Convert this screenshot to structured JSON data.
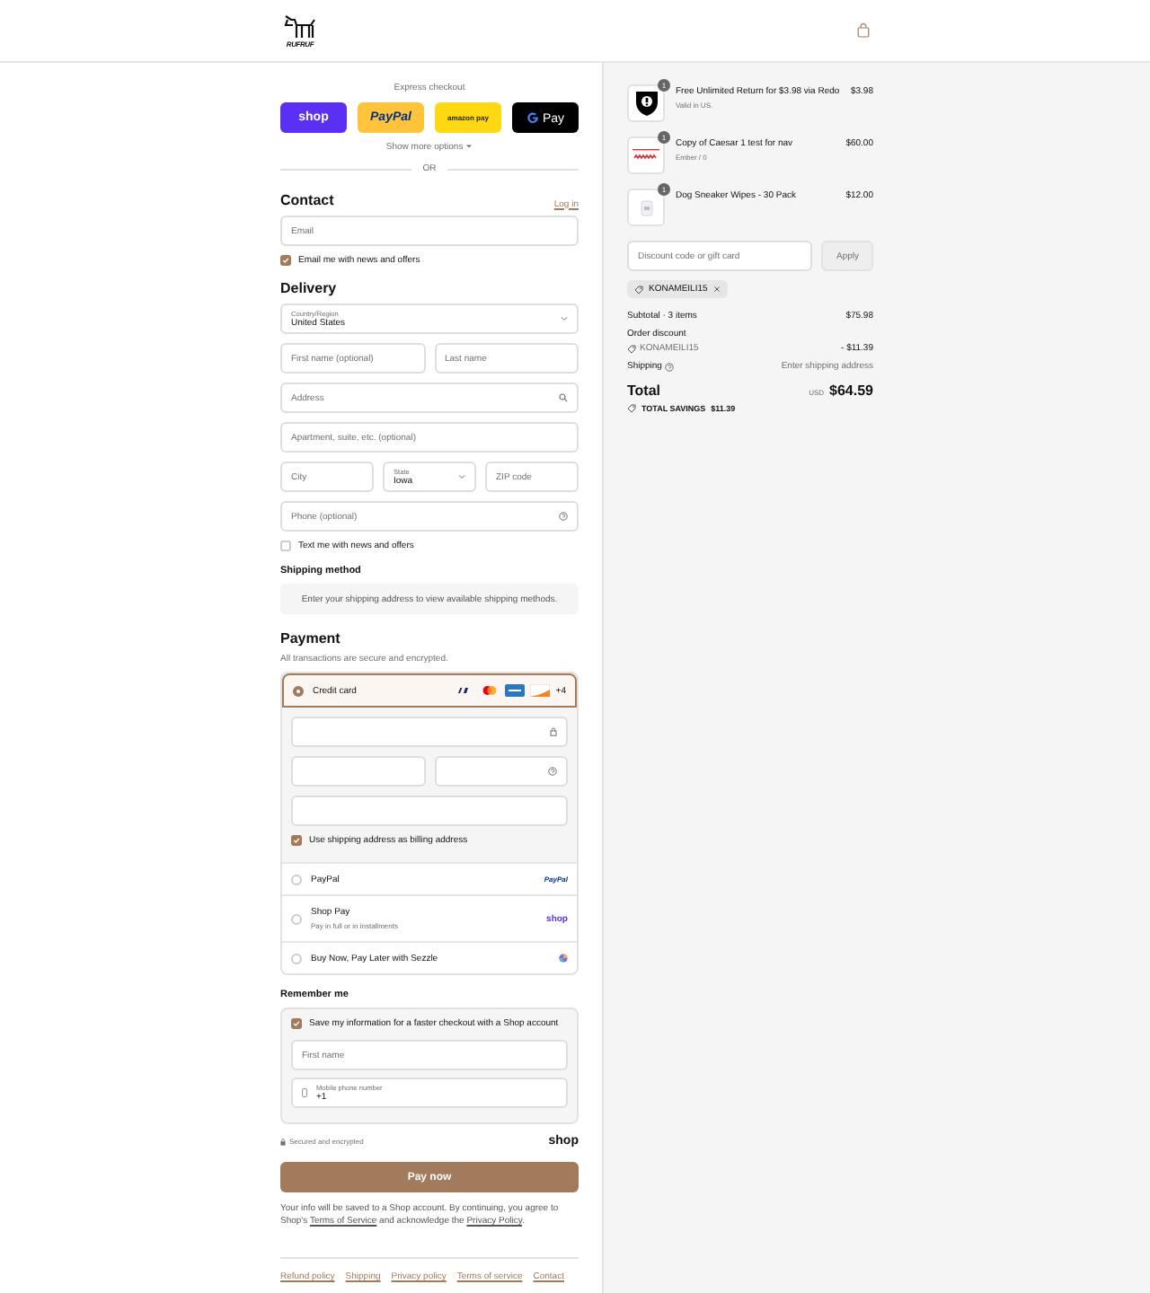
{
  "header": {
    "brand": "RUFRUF"
  },
  "express": {
    "label": "Express checkout",
    "buttons": [
      {
        "kind": "shop",
        "label": "shop"
      },
      {
        "kind": "paypal",
        "label": "PayPal"
      },
      {
        "kind": "amazon",
        "label": "amazon pay"
      },
      {
        "kind": "gpay",
        "label": "Pay"
      }
    ],
    "show_more": "Show more options",
    "or": "OR"
  },
  "contact": {
    "title": "Contact",
    "login": "Log in",
    "email": {
      "placeholder": "Email"
    },
    "news": {
      "label": "Email me with news and offers",
      "checked": true
    }
  },
  "delivery": {
    "title": "Delivery",
    "rows": [
      [
        {
          "kind": "select",
          "label": "Country/Region",
          "value": "United States"
        }
      ],
      [
        {
          "kind": "text",
          "placeholder": "First name (optional)"
        },
        {
          "kind": "text",
          "placeholder": "Last name"
        }
      ],
      [
        {
          "kind": "search",
          "placeholder": "Address"
        }
      ],
      [
        {
          "kind": "text",
          "placeholder": "Apartment, suite, etc. (optional)"
        }
      ],
      [
        {
          "kind": "text",
          "placeholder": "City"
        },
        {
          "kind": "select",
          "label": "State",
          "value": "Iowa"
        },
        {
          "kind": "text",
          "placeholder": "ZIP code"
        }
      ],
      [
        {
          "kind": "help",
          "placeholder": "Phone (optional)"
        }
      ]
    ],
    "sms": {
      "label": "Text me with news and offers",
      "checked": false
    }
  },
  "shipping_method": {
    "title": "Shipping method",
    "notice": "Enter your shipping address to view available shipping methods."
  },
  "payment": {
    "title": "Payment",
    "subtitle": "All transactions are secure and encrypted.",
    "more_brands": "+4",
    "methods": [
      {
        "kind": "card",
        "label": "Credit card",
        "selected": true
      },
      {
        "kind": "paypal",
        "label": "PayPal",
        "logo": "PayPal",
        "selected": false
      },
      {
        "kind": "shop",
        "label": "Shop Pay",
        "sub": "Pay in full or in installments",
        "logo": "shop",
        "selected": false
      },
      {
        "kind": "sezzle",
        "label": "Buy Now, Pay Later with Sezzle",
        "selected": false
      }
    ],
    "billing": {
      "label": "Use shipping address as billing address",
      "checked": true
    }
  },
  "remember": {
    "title": "Remember me",
    "save": {
      "label": "Save my information for a faster checkout with a Shop account",
      "checked": true
    },
    "first_name": {
      "placeholder": "First name"
    },
    "mobile": {
      "label": "Mobile phone number",
      "value": "+1"
    }
  },
  "secure": {
    "label": "Secured and encrypted",
    "logo": "shop"
  },
  "pay_button": "Pay now",
  "legal": [
    {
      "text": "Your info will be saved to a Shop account. By continuing, you agree to Shop's ",
      "link": false
    },
    {
      "text": "Terms of Service",
      "link": true
    },
    {
      "text": " and acknowledge the ",
      "link": false
    },
    {
      "text": "Privacy Policy",
      "link": true
    },
    {
      "text": ".",
      "link": false
    }
  ],
  "footer_links": [
    "Refund policy",
    "Shipping",
    "Privacy policy",
    "Terms of service",
    "Contact"
  ],
  "summary": {
    "items": [
      {
        "kind": "shield",
        "name": "Free Unlimited Return for $3.98 via Redo",
        "sub": "Valid in US.",
        "qty": "1",
        "price": "$3.98"
      },
      {
        "kind": "card",
        "name": "Copy of Caesar 1 test for nav",
        "sub": "Ember / 0",
        "qty": "1",
        "price": "$60.00"
      },
      {
        "kind": "pack",
        "name": "Dog Sneaker Wipes - 30 Pack",
        "qty": "1",
        "price": "$12.00"
      }
    ],
    "discount": {
      "placeholder": "Discount code or gift card",
      "apply": "Apply"
    },
    "tag": "KONAMEILI15",
    "subtotal": {
      "label": "Subtotal · 3 items",
      "value": "$75.98"
    },
    "order_discount": {
      "label": "Order discount",
      "code": "KONAMEILI15",
      "value": "- $11.39"
    },
    "shipping": {
      "label": "Shipping",
      "value": "Enter shipping address"
    },
    "total": {
      "label": "Total",
      "currency": "USD",
      "value": "$64.59"
    },
    "savings": {
      "label": "TOTAL SAVINGS",
      "value": "$11.39"
    }
  }
}
